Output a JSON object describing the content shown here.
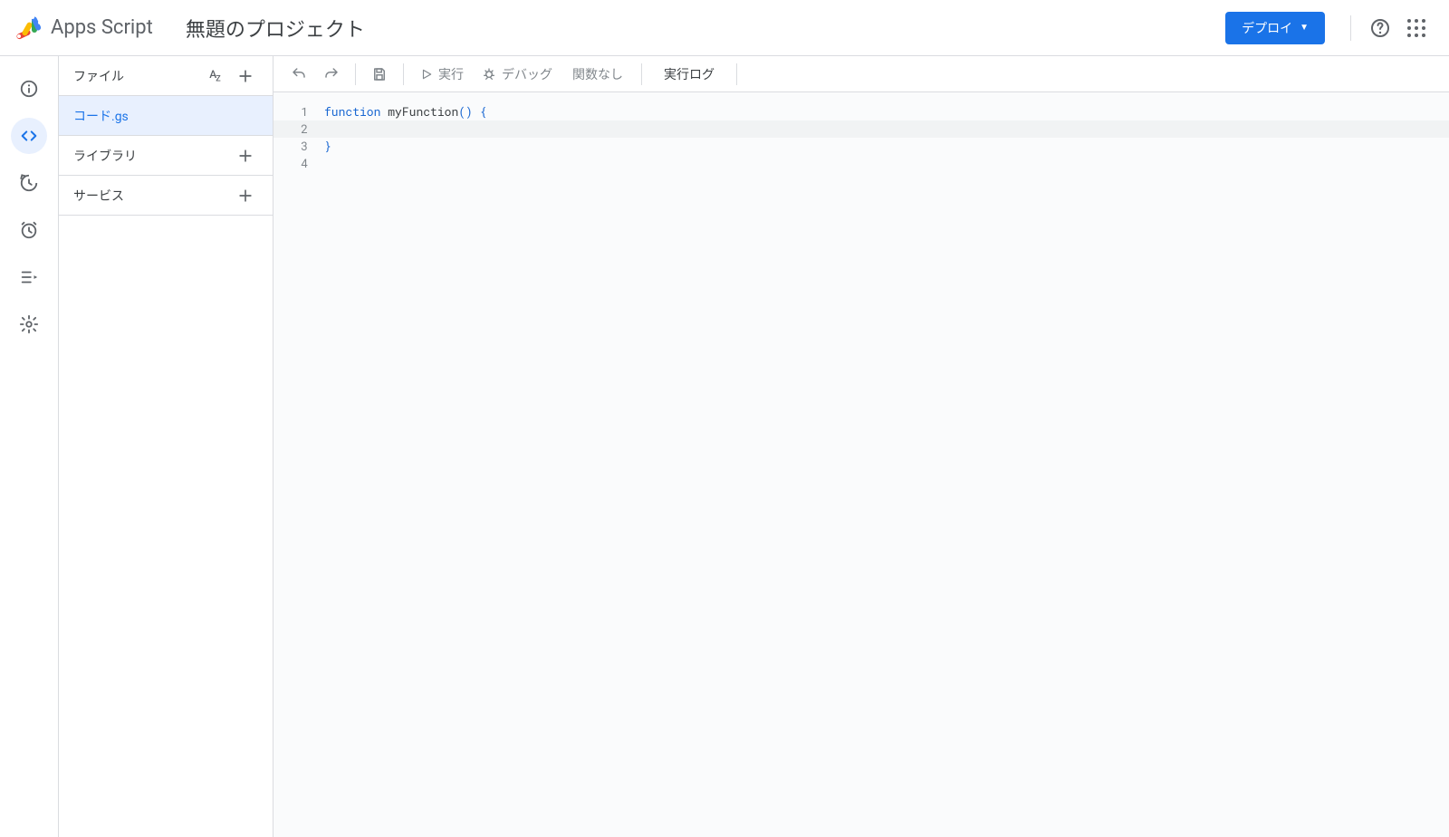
{
  "header": {
    "product_name": "Apps Script",
    "project_title": "無題のプロジェクト",
    "deploy_label": "デプロイ"
  },
  "rail": {
    "items": [
      {
        "name": "info",
        "active": false
      },
      {
        "name": "editor",
        "active": true
      },
      {
        "name": "history",
        "active": false
      },
      {
        "name": "triggers",
        "active": false
      },
      {
        "name": "executions",
        "active": false
      },
      {
        "name": "settings",
        "active": false
      }
    ]
  },
  "sidebar": {
    "files_label": "ファイル",
    "libraries_label": "ライブラリ",
    "services_label": "サービス",
    "files": [
      {
        "name": "コード.gs",
        "active": true
      }
    ]
  },
  "toolbar": {
    "run_label": "実行",
    "debug_label": "デバッグ",
    "function_label": "関数なし",
    "log_label": "実行ログ"
  },
  "editor": {
    "lines": [
      {
        "n": "1",
        "tokens": [
          {
            "t": "function",
            "c": "kw"
          },
          {
            "t": " ",
            "c": ""
          },
          {
            "t": "myFunction",
            "c": "id"
          },
          {
            "t": "()",
            "c": "brace"
          },
          {
            "t": " ",
            "c": ""
          },
          {
            "t": "{",
            "c": "brace"
          }
        ],
        "hl": false
      },
      {
        "n": "2",
        "tokens": [
          {
            "t": "  ",
            "c": ""
          }
        ],
        "hl": true
      },
      {
        "n": "3",
        "tokens": [
          {
            "t": "}",
            "c": "brace"
          }
        ],
        "hl": false
      },
      {
        "n": "4",
        "tokens": [],
        "hl": false
      }
    ]
  }
}
